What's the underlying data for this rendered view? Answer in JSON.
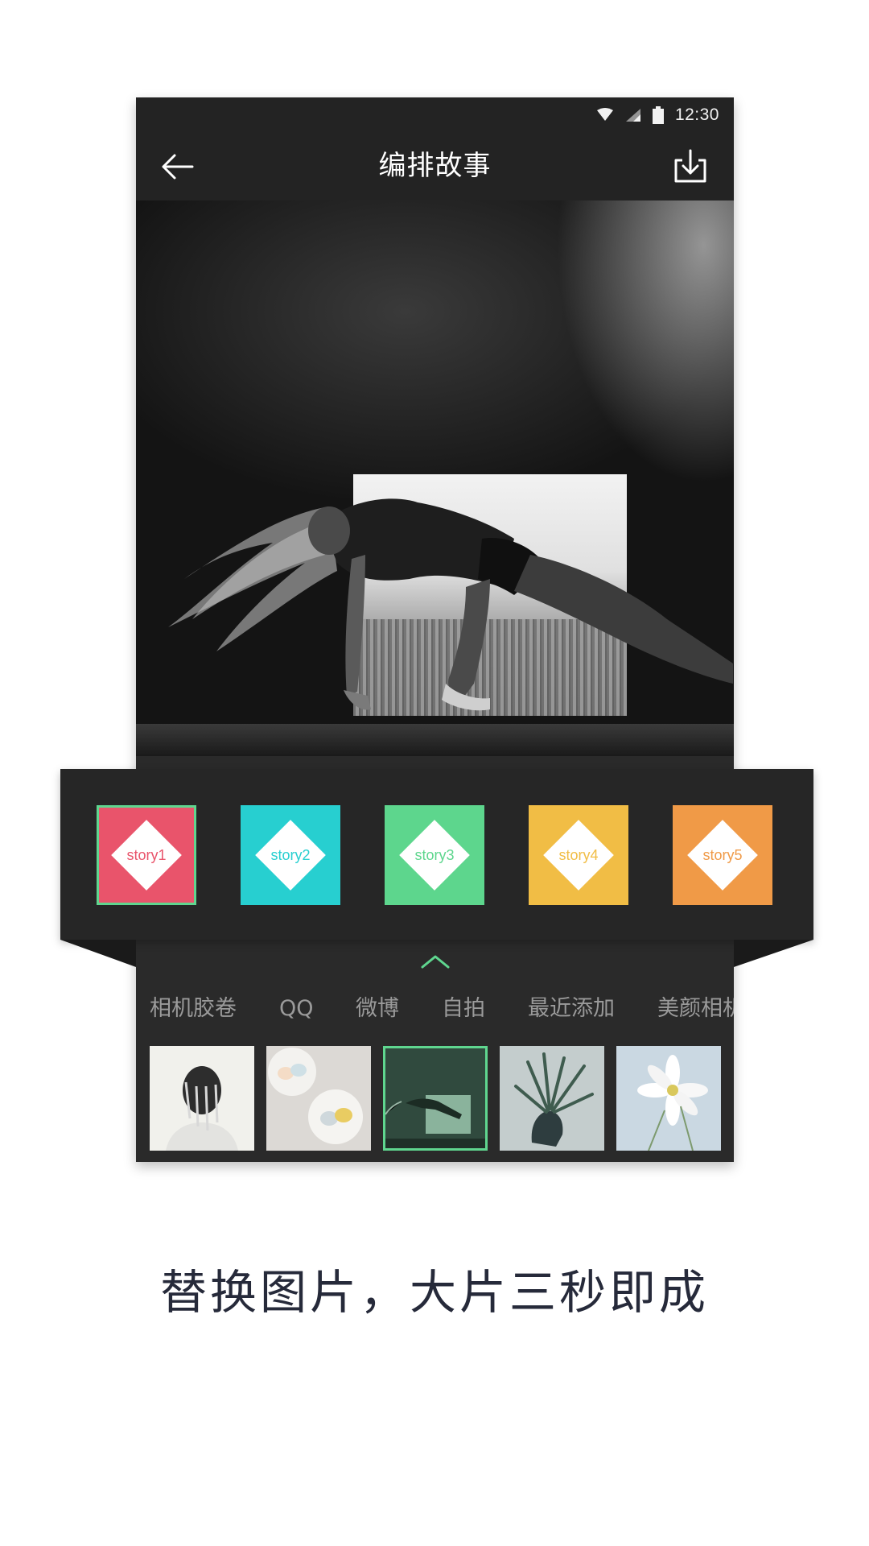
{
  "status_bar": {
    "time": "12:30",
    "icons": [
      "wifi-icon",
      "signal-icon",
      "battery-icon"
    ]
  },
  "app_bar": {
    "title": "编排故事",
    "back_icon": "arrow-left-icon",
    "download_icon": "download-icon"
  },
  "stories": [
    {
      "label": "story1",
      "color": "#e9546b",
      "text_color": "#e9546b",
      "selected": true
    },
    {
      "label": "story2",
      "color": "#27cfd0",
      "text_color": "#27cfd0",
      "selected": false
    },
    {
      "label": "story3",
      "color": "#5dd68d",
      "text_color": "#5dd68d",
      "selected": false
    },
    {
      "label": "story4",
      "color": "#f1bd45",
      "text_color": "#f1bd45",
      "selected": false
    },
    {
      "label": "story5",
      "color": "#f09a47",
      "text_color": "#f09a47",
      "selected": false
    }
  ],
  "source_tabs": [
    {
      "label": "相机胶卷",
      "active": true
    },
    {
      "label": "QQ",
      "active": false
    },
    {
      "label": "微博",
      "active": false
    },
    {
      "label": "自拍",
      "active": false
    },
    {
      "label": "最近添加",
      "active": false
    },
    {
      "label": "美颜相机",
      "active": false
    }
  ],
  "thumbnails": [
    {
      "name": "thumb-portrait",
      "selected": false
    },
    {
      "name": "thumb-macarons",
      "selected": false
    },
    {
      "name": "thumb-dancer",
      "selected": true
    },
    {
      "name": "thumb-plant-head",
      "selected": false
    },
    {
      "name": "thumb-flower",
      "selected": false
    }
  ],
  "accent_color": "#5fd68f",
  "caption": "替换图片，大片三秒即成"
}
